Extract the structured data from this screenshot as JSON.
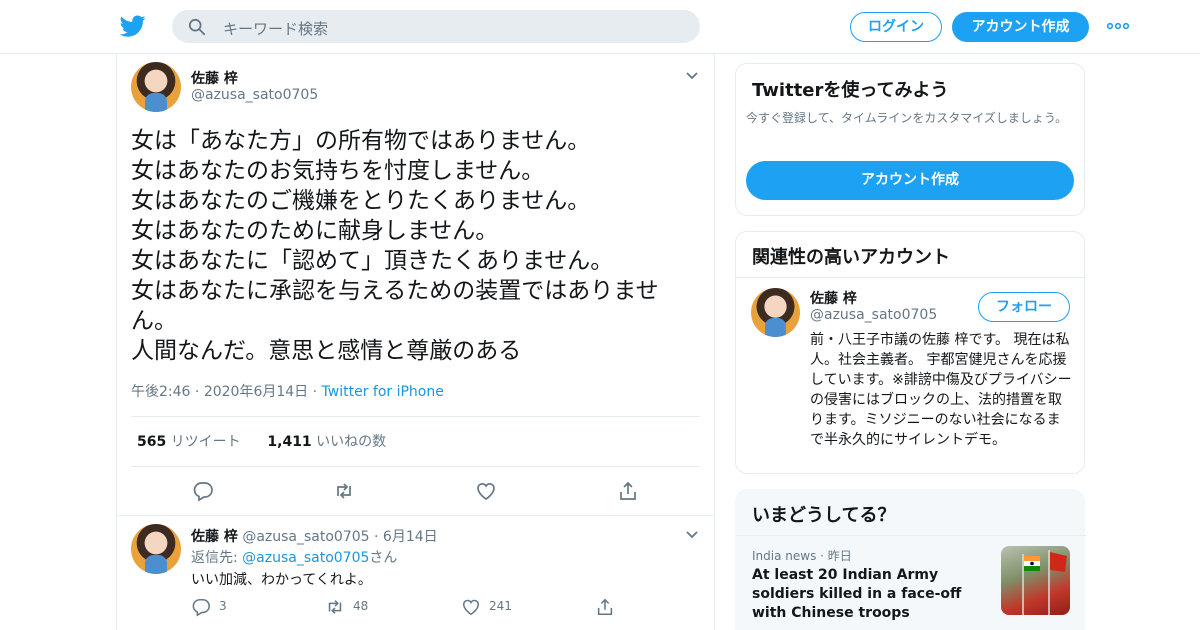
{
  "header": {
    "search_placeholder": "キーワード検索",
    "login_label": "ログイン",
    "signup_label": "アカウント作成",
    "brand_color": "#1da1f2"
  },
  "tweet": {
    "name": "佐藤 梓",
    "handle": "@azusa_sato0705",
    "text": "女は「あなた方」の所有物ではありません。\n女はあなたのお気持ちを忖度しません。\n女はあなたのご機嫌をとりたくありません。\n女はあなたのために献身しません。\n女はあなたに「認めて」頂きたくありません。\n女はあなたに承認を与えるための装置ではありません。\n人間なんだ。意思と感情と尊厳のある",
    "time": "午後2:46",
    "date": "2020年6月14日",
    "source": "Twitter for iPhone",
    "retweets_count": "565",
    "retweets_label": "リツイート",
    "likes_count": "1,411",
    "likes_label": "いいねの数"
  },
  "reply": {
    "name": "佐藤 梓",
    "handle": "@azusa_sato0705",
    "date": "6月14日",
    "reply_prefix": "返信先: ",
    "reply_to": "@azusa_sato0705",
    "reply_suffix": "さん",
    "text": "いい加減、わかってくれよ。",
    "replies": "3",
    "retweets": "48",
    "likes": "241"
  },
  "sidebar": {
    "signup_card": {
      "title": "Twitterを使ってみよう",
      "subtitle": "今すぐ登録して、タイムラインをカスタマイズしましょう。",
      "button": "アカウント作成"
    },
    "related": {
      "title": "関連性の高いアカウント",
      "name": "佐藤 梓",
      "handle": "@azusa_sato0705",
      "follow_label": "フォロー",
      "bio": "前・八王子市議の佐藤 梓です。 現在は私人。社会主義者。 宇都宮健児さんを応援しています。※誹謗中傷及びプライバシーの侵害にはブロックの上、法的措置を取ります。ミソジニーのない社会になるまで半永久的にサイレントデモ。"
    },
    "trends": {
      "title": "いまどうしてる？",
      "source": "India news",
      "time": "昨日",
      "headline": "At least 20 Indian Army soldiers killed in a face-off with Chinese troops"
    }
  }
}
